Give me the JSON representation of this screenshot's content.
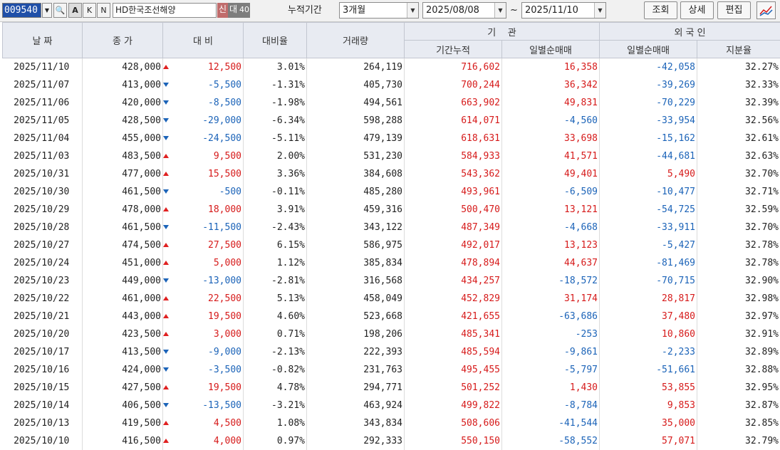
{
  "toolbar": {
    "code": "009540",
    "btn_search": "🔍",
    "btn_a": "A",
    "btn_k": "K",
    "btn_n": "N",
    "stock_name": "HD한국조선해양",
    "badge_sin": "신",
    "badge_dae": "대",
    "badge_40": "40",
    "period_label": "누적기간",
    "period_value": "3개월",
    "date_from": "2025/08/08",
    "tilde": "~",
    "date_to": "2025/11/10",
    "btn_query": "조회",
    "btn_detail": "상세",
    "btn_edit": "편집",
    "graph_icon": "chart-line-icon"
  },
  "header": {
    "date": "날 짜",
    "close": "종 가",
    "change": "대 비",
    "change_rate": "대비율",
    "volume": "거래량",
    "institution": "기    관",
    "inst_cum": "기간누적",
    "inst_daily": "일별순매매",
    "foreign": "외 국 인",
    "for_daily": "일별순매매",
    "for_ratio": "지분율"
  },
  "colors": {
    "up": "#d61a1a",
    "down": "#1b63b8",
    "header_bg": "#e8ebf2",
    "code_bg": "#1f4fa8",
    "badge_sin": "#c06c6c",
    "badge_dae": "#7d7d7d",
    "badge_40": "#7d7d7d"
  },
  "rows": [
    {
      "date": "2025/11/10",
      "close": "428,000",
      "dir": "up",
      "change": "12,500",
      "rate": "3.01%",
      "volume": "264,119",
      "inst_cum": "716,602",
      "inst_daily": "16,358",
      "for_daily": "-42,058",
      "ratio": "32.27%"
    },
    {
      "date": "2025/11/07",
      "close": "413,000",
      "dir": "dn",
      "change": "-5,500",
      "rate": "-1.31%",
      "volume": "405,730",
      "inst_cum": "700,244",
      "inst_daily": "36,342",
      "for_daily": "-39,269",
      "ratio": "32.33%"
    },
    {
      "date": "2025/11/06",
      "close": "420,000",
      "dir": "dn",
      "change": "-8,500",
      "rate": "-1.98%",
      "volume": "494,561",
      "inst_cum": "663,902",
      "inst_daily": "49,831",
      "for_daily": "-70,229",
      "ratio": "32.39%"
    },
    {
      "date": "2025/11/05",
      "close": "428,500",
      "dir": "dn",
      "change": "-29,000",
      "rate": "-6.34%",
      "volume": "598,288",
      "inst_cum": "614,071",
      "inst_daily": "-4,560",
      "for_daily": "-33,954",
      "ratio": "32.56%"
    },
    {
      "date": "2025/11/04",
      "close": "455,000",
      "dir": "dn",
      "change": "-24,500",
      "rate": "-5.11%",
      "volume": "479,139",
      "inst_cum": "618,631",
      "inst_daily": "33,698",
      "for_daily": "-15,162",
      "ratio": "32.61%"
    },
    {
      "date": "2025/11/03",
      "close": "483,500",
      "dir": "up",
      "change": "9,500",
      "rate": "2.00%",
      "volume": "531,230",
      "inst_cum": "584,933",
      "inst_daily": "41,571",
      "for_daily": "-44,681",
      "ratio": "32.63%"
    },
    {
      "date": "2025/10/31",
      "close": "477,000",
      "dir": "up",
      "change": "15,500",
      "rate": "3.36%",
      "volume": "384,608",
      "inst_cum": "543,362",
      "inst_daily": "49,401",
      "for_daily": "5,490",
      "ratio": "32.70%"
    },
    {
      "date": "2025/10/30",
      "close": "461,500",
      "dir": "dn",
      "change": "-500",
      "rate": "-0.11%",
      "volume": "485,280",
      "inst_cum": "493,961",
      "inst_daily": "-6,509",
      "for_daily": "-10,477",
      "ratio": "32.71%"
    },
    {
      "date": "2025/10/29",
      "close": "478,000",
      "dir": "up",
      "change": "18,000",
      "rate": "3.91%",
      "volume": "459,316",
      "inst_cum": "500,470",
      "inst_daily": "13,121",
      "for_daily": "-54,725",
      "ratio": "32.59%"
    },
    {
      "date": "2025/10/28",
      "close": "461,500",
      "dir": "dn",
      "change": "-11,500",
      "rate": "-2.43%",
      "volume": "343,122",
      "inst_cum": "487,349",
      "inst_daily": "-4,668",
      "for_daily": "-33,911",
      "ratio": "32.70%"
    },
    {
      "date": "2025/10/27",
      "close": "474,500",
      "dir": "up",
      "change": "27,500",
      "rate": "6.15%",
      "volume": "586,975",
      "inst_cum": "492,017",
      "inst_daily": "13,123",
      "for_daily": "-5,427",
      "ratio": "32.78%"
    },
    {
      "date": "2025/10/24",
      "close": "451,000",
      "dir": "up",
      "change": "5,000",
      "rate": "1.12%",
      "volume": "385,834",
      "inst_cum": "478,894",
      "inst_daily": "44,637",
      "for_daily": "-81,469",
      "ratio": "32.78%"
    },
    {
      "date": "2025/10/23",
      "close": "449,000",
      "dir": "dn",
      "change": "-13,000",
      "rate": "-2.81%",
      "volume": "316,568",
      "inst_cum": "434,257",
      "inst_daily": "-18,572",
      "for_daily": "-70,715",
      "ratio": "32.90%"
    },
    {
      "date": "2025/10/22",
      "close": "461,000",
      "dir": "up",
      "change": "22,500",
      "rate": "5.13%",
      "volume": "458,049",
      "inst_cum": "452,829",
      "inst_daily": "31,174",
      "for_daily": "28,817",
      "ratio": "32.98%"
    },
    {
      "date": "2025/10/21",
      "close": "443,000",
      "dir": "up",
      "change": "19,500",
      "rate": "4.60%",
      "volume": "523,668",
      "inst_cum": "421,655",
      "inst_daily": "-63,686",
      "for_daily": "37,480",
      "ratio": "32.97%"
    },
    {
      "date": "2025/10/20",
      "close": "423,500",
      "dir": "up",
      "change": "3,000",
      "rate": "0.71%",
      "volume": "198,206",
      "inst_cum": "485,341",
      "inst_daily": "-253",
      "for_daily": "10,860",
      "ratio": "32.91%"
    },
    {
      "date": "2025/10/17",
      "close": "413,500",
      "dir": "dn",
      "change": "-9,000",
      "rate": "-2.13%",
      "volume": "222,393",
      "inst_cum": "485,594",
      "inst_daily": "-9,861",
      "for_daily": "-2,233",
      "ratio": "32.89%"
    },
    {
      "date": "2025/10/16",
      "close": "424,000",
      "dir": "dn",
      "change": "-3,500",
      "rate": "-0.82%",
      "volume": "231,763",
      "inst_cum": "495,455",
      "inst_daily": "-5,797",
      "for_daily": "-51,661",
      "ratio": "32.88%"
    },
    {
      "date": "2025/10/15",
      "close": "427,500",
      "dir": "up",
      "change": "19,500",
      "rate": "4.78%",
      "volume": "294,771",
      "inst_cum": "501,252",
      "inst_daily": "1,430",
      "for_daily": "53,855",
      "ratio": "32.95%"
    },
    {
      "date": "2025/10/14",
      "close": "406,500",
      "dir": "dn",
      "change": "-13,500",
      "rate": "-3.21%",
      "volume": "463,924",
      "inst_cum": "499,822",
      "inst_daily": "-8,784",
      "for_daily": "9,853",
      "ratio": "32.87%"
    },
    {
      "date": "2025/10/13",
      "close": "419,500",
      "dir": "up",
      "change": "4,500",
      "rate": "1.08%",
      "volume": "343,834",
      "inst_cum": "508,606",
      "inst_daily": "-41,544",
      "for_daily": "35,000",
      "ratio": "32.85%"
    },
    {
      "date": "2025/10/10",
      "close": "416,500",
      "dir": "up",
      "change": "4,000",
      "rate": "0.97%",
      "volume": "292,333",
      "inst_cum": "550,150",
      "inst_daily": "-58,552",
      "for_daily": "57,071",
      "ratio": "32.79%"
    }
  ]
}
